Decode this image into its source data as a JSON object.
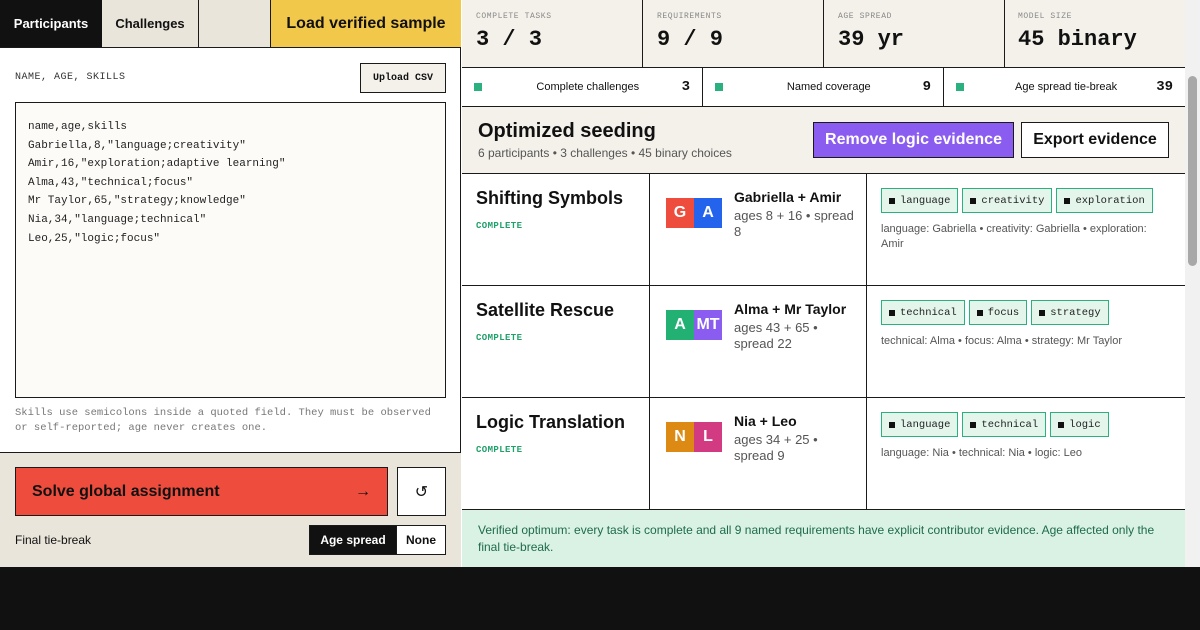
{
  "tabs": {
    "participants": "Participants",
    "challenges": "Challenges",
    "load_sample": "Load verified sample"
  },
  "csv": {
    "label": "NAME, AGE, SKILLS",
    "upload": "Upload CSV",
    "content": "name,age,skills\nGabriella,8,\"language;creativity\"\nAmir,16,\"exploration;adaptive learning\"\nAlma,43,\"technical;focus\"\nMr Taylor,65,\"strategy;knowledge\"\nNia,34,\"language;technical\"\nLeo,25,\"logic;focus\"",
    "help": "Skills use semicolons inside a quoted field. They must be observed or self-reported; age never creates one."
  },
  "actions": {
    "solve": "Solve global assignment",
    "solve_arrow": "→",
    "reset_glyph": "↺",
    "tiebreak_label": "Final tie-break",
    "tiebreak_options": [
      "Age spread",
      "None"
    ],
    "tiebreak_selected": "Age spread"
  },
  "stats": [
    {
      "label": "COMPLETE TASKS",
      "value": "3 / 3"
    },
    {
      "label": "REQUIREMENTS",
      "value": "9 / 9"
    },
    {
      "label": "AGE SPREAD",
      "value": "39 yr"
    },
    {
      "label": "MODEL SIZE",
      "value": "45 binary"
    }
  ],
  "metrics": [
    {
      "label": "Complete challenges",
      "value": "3"
    },
    {
      "label": "Named coverage",
      "value": "9"
    },
    {
      "label": "Age spread tie-break",
      "value": "39"
    }
  ],
  "header": {
    "title": "Optimized seeding",
    "subtitle": "6 participants • 3 challenges • 45 binary choices",
    "remove": "Remove logic evidence",
    "export": "Export evidence"
  },
  "challenges": [
    {
      "title": "Shifting Symbols",
      "status": "COMPLETE",
      "avatars": [
        {
          "initials": "G",
          "color": "#ee4d3e"
        },
        {
          "initials": "A",
          "color": "#2463eb"
        }
      ],
      "pair": "Gabriella + Amir",
      "info": "ages 8 + 16 • spread 8",
      "tags": [
        "language",
        "creativity",
        "exploration"
      ],
      "evidence": "language: Gabriella • creativity: Gabriella • exploration: Amir"
    },
    {
      "title": "Satellite Rescue",
      "status": "COMPLETE",
      "avatars": [
        {
          "initials": "A",
          "color": "#22b073"
        },
        {
          "initials": "MT",
          "color": "#8a5cf0"
        }
      ],
      "pair": "Alma + Mr Taylor",
      "info": "ages 43 + 65 • spread 22",
      "tags": [
        "technical",
        "focus",
        "strategy"
      ],
      "evidence": "technical: Alma • focus: Alma • strategy: Mr Taylor"
    },
    {
      "title": "Logic Translation",
      "status": "COMPLETE",
      "avatars": [
        {
          "initials": "N",
          "color": "#dd8a14"
        },
        {
          "initials": "L",
          "color": "#d23a82"
        }
      ],
      "pair": "Nia + Leo",
      "info": "ages 34 + 25 • spread 9",
      "tags": [
        "language",
        "technical",
        "logic"
      ],
      "evidence": "language: Nia • technical: Nia • logic: Leo"
    }
  ],
  "verified": "Verified optimum: every task is complete and all 9 named requirements have explicit contributor evidence. Age affected only the final tie-break."
}
